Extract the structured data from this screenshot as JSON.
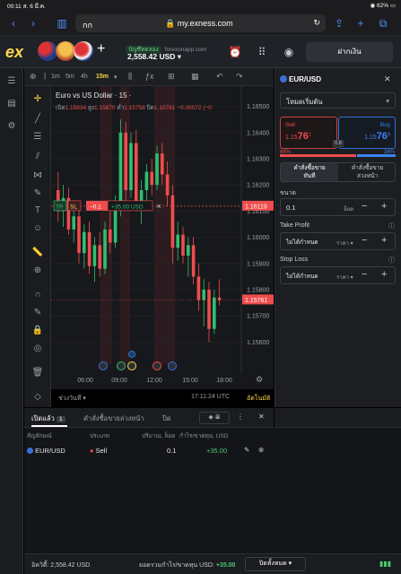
{
  "status_bar": {
    "time": "00:11",
    "date": "ส. 6 มี.ค.",
    "battery": "62%"
  },
  "browser": {
    "aa_label": "กก",
    "url": "my.exness.com"
  },
  "header": {
    "logo": "ex",
    "account_type": "บัญชีทดลอง",
    "server": "forexonapp.com",
    "balance": "2,558.42 USD",
    "deposit_button": "ฝากเงิน"
  },
  "chart": {
    "timeframes": [
      "1m",
      "5m",
      "4h",
      "15m"
    ],
    "active_timeframe": "15m",
    "title": "Euro vs US Dollar · 15 ·",
    "ohlc": {
      "open_label": "เปิด",
      "open": "1.15834",
      "high_label": "สูง",
      "high": "1.15870",
      "low_label": "ต่ำ",
      "low": "1.15758",
      "close_label": "ปิด",
      "close": "1.15761",
      "change": "−0.00072 (−0"
    },
    "price_ticks": [
      "1.16500",
      "1.16400",
      "1.16300",
      "1.16200",
      "1.16100",
      "1.16000",
      "1.15900",
      "1.15800",
      "1.15700",
      "1.15600"
    ],
    "time_ticks": [
      "06:00",
      "09:00",
      "12:00",
      "15:00",
      "18:00"
    ],
    "position_line": {
      "tp": "TP",
      "sl": "SL",
      "volume": "−0.1",
      "pnl": "+35.00 USD",
      "price": "1.16119"
    },
    "current_price": "1.15761",
    "range_selector": "ช่วงวันที่",
    "clock": "17:11:24 UTC",
    "auto_label": "อัตโนมัติ"
  },
  "order_panel": {
    "symbol": "EUR/USD",
    "mode": "โหมดเริ่มต้น",
    "sell_label": "Sell",
    "sell_price_main": "1.15",
    "sell_price_big": "76",
    "sell_price_sup": "1",
    "buy_label": "Buy",
    "buy_price_main": "1.15",
    "buy_price_big": "76",
    "buy_price_sup": "9",
    "spread": "0.8",
    "sentiment_sell": "66%",
    "sentiment_buy": "34%",
    "sentiment_sell_fraction": 0.66,
    "order_tab_market": "คำสั่งซื้อขาย\nทันที",
    "order_tab_pending": "คำสั่งซื้อขาย\nล่วงหน้า",
    "volume_label": "ขนาด",
    "volume_value": "0.1",
    "volume_unit": "ล็อต",
    "tp_label": "Take Profit",
    "tp_value": "ไม่ได้กำหนด",
    "tp_unit": "ราคา",
    "sl_label": "Stop Loss",
    "sl_value": "ไม่ได้กำหนด",
    "sl_unit": "ราคา"
  },
  "positions": {
    "tabs": [
      "เปิดแล้ว",
      "คำสั่งซื้อขายล่วงหน้า",
      "ปิด"
    ],
    "open_count": "1",
    "columns": [
      "สัญลักษณ์",
      "ประเภท",
      "ปริมาณ, ล็อต",
      "กำไร/ขาดทุน, USD"
    ],
    "rows": [
      {
        "symbol": "EUR/USD",
        "type": "Sell",
        "volume": "0.1",
        "pnl": "+35.00"
      }
    ]
  },
  "footer": {
    "equity_label": "อิควิตี้:",
    "equity_value": "2,558.42 USD",
    "pnl_label": "ยอดรวมกำไร/ขาดทุน USD:",
    "pnl_value": "+35.00",
    "close_all": "ปิดทั้งหมด"
  },
  "colors": {
    "bull": "#ef4d4d",
    "bear": "#ef4d4d",
    "buy": "#3b82f6",
    "sell": "#ef4d4d",
    "pnl": "#4cc971"
  }
}
